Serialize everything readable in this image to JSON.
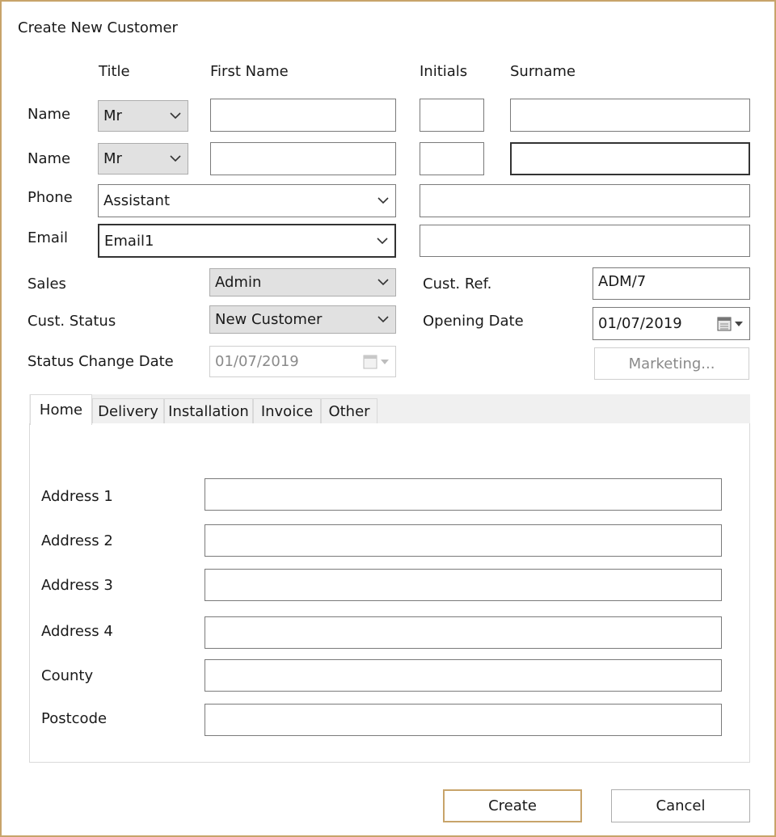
{
  "window": {
    "title": "Create New Customer"
  },
  "headers": {
    "title": "Title",
    "first_name": "First Name",
    "initials": "Initials",
    "surname": "Surname"
  },
  "name_rows": [
    {
      "label": "Name",
      "title_value": "Mr",
      "first_name": "",
      "initials": "",
      "surname": ""
    },
    {
      "label": "Name",
      "title_value": "Mr",
      "first_name": "",
      "initials": "",
      "surname": ""
    }
  ],
  "phone": {
    "label": "Phone",
    "type_value": "Assistant",
    "value": ""
  },
  "email": {
    "label": "Email",
    "type_value": "Email1",
    "value": ""
  },
  "sales": {
    "label": "Sales",
    "value": "Admin"
  },
  "cust_status": {
    "label": "Cust. Status",
    "value": "New Customer"
  },
  "status_change_date": {
    "label": "Status Change Date",
    "value": "01/07/2019"
  },
  "cust_ref": {
    "label": "Cust. Ref.",
    "value": "ADM/7"
  },
  "opening_date": {
    "label": "Opening Date",
    "value": "01/07/2019"
  },
  "marketing_button": "Marketing...",
  "tabs": [
    {
      "label": "Home",
      "active": true
    },
    {
      "label": "Delivery",
      "active": false
    },
    {
      "label": "Installation",
      "active": false
    },
    {
      "label": "Invoice",
      "active": false
    },
    {
      "label": "Other",
      "active": false
    }
  ],
  "address": {
    "fields": [
      {
        "label": "Address 1",
        "value": ""
      },
      {
        "label": "Address 2",
        "value": ""
      },
      {
        "label": "Address 3",
        "value": ""
      },
      {
        "label": "Address 4",
        "value": ""
      },
      {
        "label": "County",
        "value": ""
      },
      {
        "label": "Postcode",
        "value": ""
      }
    ]
  },
  "buttons": {
    "create": "Create",
    "cancel": "Cancel"
  },
  "colors": {
    "default_button_border": "#c8a46a",
    "disabled_text": "#8a8a8a",
    "combo_grey": "#e1e1e1"
  }
}
